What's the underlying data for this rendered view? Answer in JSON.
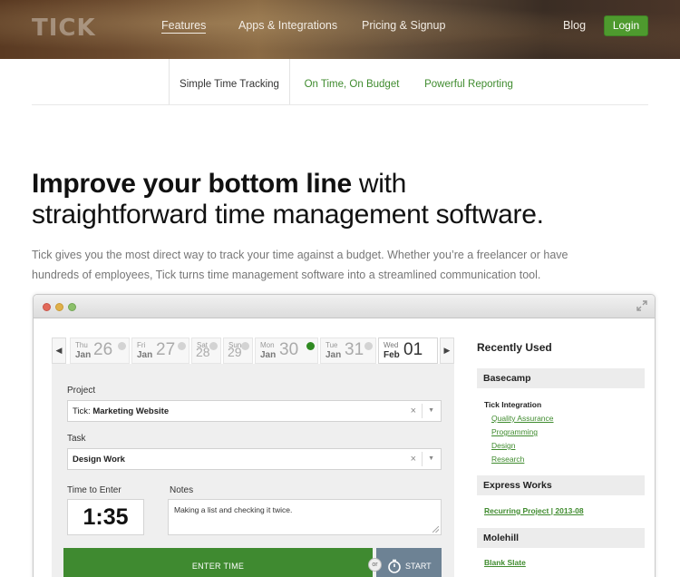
{
  "header": {
    "logo": "TICK",
    "nav": [
      {
        "label": "Features"
      },
      {
        "label": "Apps & Integrations"
      },
      {
        "label": "Pricing & Signup"
      },
      {
        "label": "Blog"
      }
    ],
    "login_label": "Login"
  },
  "subtabs": [
    {
      "label": "Simple Time Tracking"
    },
    {
      "label": "On Time, On Budget"
    },
    {
      "label": "Powerful Reporting"
    }
  ],
  "hero": {
    "title_bold": "Improve your bottom line",
    "title_rest": " with",
    "title_line2": "straightforward time management software.",
    "description": "Tick gives you the most direct way to track your time against a budget. Whether you’re a freelancer or have hundreds of employees, Tick turns time management software into a streamlined communication tool."
  },
  "app": {
    "colors": {
      "close": "#e26a5a",
      "minimize": "#e0b04a",
      "zoom": "#8cc06a",
      "accent": "#3f8a30"
    },
    "days": [
      {
        "dow": "Thu",
        "mon": "Jan",
        "num": "26"
      },
      {
        "dow": "Fri",
        "mon": "Jan",
        "num": "27"
      },
      {
        "dow": "Sat",
        "mon": "",
        "num": "28"
      },
      {
        "dow": "Sun",
        "mon": "",
        "num": "29"
      },
      {
        "dow": "Mon",
        "mon": "Jan",
        "num": "30"
      },
      {
        "dow": "Tue",
        "mon": "Jan",
        "num": "31"
      },
      {
        "dow": "Wed",
        "mon": "Feb",
        "num": "01"
      }
    ],
    "project_label": "Project",
    "project_prefix": "Tick: ",
    "project_value": "Marketing Website",
    "task_label": "Task",
    "task_value": "Design Work",
    "time_label": "Time to Enter",
    "time_value": "1:35",
    "notes_label": "Notes",
    "notes_value": "Making a list and checking it twice.",
    "enter_label": "ENTER TIME",
    "or_label": "or",
    "start_label": "START"
  },
  "recent": {
    "title": "Recently Used",
    "groups": [
      {
        "name": "Basecamp",
        "sub": "Tick Integration",
        "links": [
          "Quality Assurance",
          "Programming",
          "Design",
          "Research"
        ]
      },
      {
        "name": "Express Works",
        "links": [
          "Recurring Project | 2013-08"
        ]
      },
      {
        "name": "Molehill",
        "links": [
          "Blank Slate"
        ]
      }
    ]
  }
}
